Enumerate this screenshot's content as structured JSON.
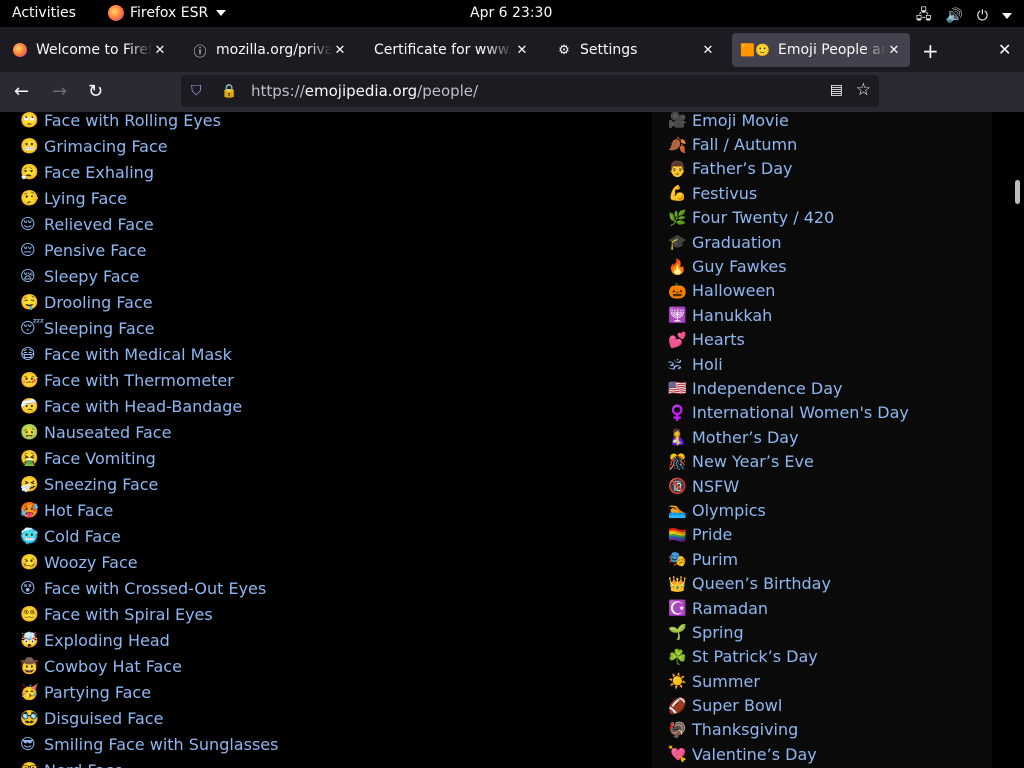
{
  "topbar": {
    "activities": "Activities",
    "app_name": "Firefox ESR",
    "clock": "Apr 6  23:30"
  },
  "tabs": [
    {
      "label": "Welcome to Firefox",
      "icon": "firefox-icon"
    },
    {
      "label": "mozilla.org/privacy",
      "icon": "info-icon"
    },
    {
      "label": "Certificate for www.mozilla",
      "icon": ""
    },
    {
      "label": "Settings",
      "icon": "gear-icon"
    },
    {
      "label": "Emoji People and Smileys",
      "icon": "emojipedia-icon"
    }
  ],
  "urlbar": {
    "prefix": "https://",
    "host": "emojipedia.org",
    "path": "/people/"
  },
  "left_list": [
    {
      "emoji": "🙄",
      "label": "Face with Rolling Eyes"
    },
    {
      "emoji": "😬",
      "label": "Grimacing Face"
    },
    {
      "emoji": "😮‍💨",
      "label": "Face Exhaling"
    },
    {
      "emoji": "🤥",
      "label": "Lying Face"
    },
    {
      "emoji": "😌",
      "label": "Relieved Face"
    },
    {
      "emoji": "😔",
      "label": "Pensive Face"
    },
    {
      "emoji": "😪",
      "label": "Sleepy Face"
    },
    {
      "emoji": "🤤",
      "label": "Drooling Face"
    },
    {
      "emoji": "😴",
      "label": "Sleeping Face"
    },
    {
      "emoji": "😷",
      "label": "Face with Medical Mask"
    },
    {
      "emoji": "🤒",
      "label": "Face with Thermometer"
    },
    {
      "emoji": "🤕",
      "label": "Face with Head-Bandage"
    },
    {
      "emoji": "🤢",
      "label": "Nauseated Face"
    },
    {
      "emoji": "🤮",
      "label": "Face Vomiting"
    },
    {
      "emoji": "🤧",
      "label": "Sneezing Face"
    },
    {
      "emoji": "🥵",
      "label": "Hot Face"
    },
    {
      "emoji": "🥶",
      "label": "Cold Face"
    },
    {
      "emoji": "🥴",
      "label": "Woozy Face"
    },
    {
      "emoji": "😵",
      "label": "Face with Crossed-Out Eyes"
    },
    {
      "emoji": "😵‍💫",
      "label": "Face with Spiral Eyes"
    },
    {
      "emoji": "🤯",
      "label": "Exploding Head"
    },
    {
      "emoji": "🤠",
      "label": "Cowboy Hat Face"
    },
    {
      "emoji": "🥳",
      "label": "Partying Face"
    },
    {
      "emoji": "🥸",
      "label": "Disguised Face"
    },
    {
      "emoji": "😎",
      "label": "Smiling Face with Sunglasses"
    },
    {
      "emoji": "🤓",
      "label": "Nerd Face"
    }
  ],
  "right_list": [
    {
      "emoji": "🎥",
      "label": "Emoji Movie"
    },
    {
      "emoji": "🍂",
      "label": "Fall / Autumn"
    },
    {
      "emoji": "👨",
      "label": "Father’s Day"
    },
    {
      "emoji": "💪",
      "label": "Festivus"
    },
    {
      "emoji": "🌿",
      "label": "Four Twenty / 420"
    },
    {
      "emoji": "🎓",
      "label": "Graduation"
    },
    {
      "emoji": "🔥",
      "label": "Guy Fawkes"
    },
    {
      "emoji": "🎃",
      "label": "Halloween"
    },
    {
      "emoji": "🕎",
      "label": "Hanukkah"
    },
    {
      "emoji": "💕",
      "label": "Hearts"
    },
    {
      "emoji": "🕉",
      "label": "Holi"
    },
    {
      "emoji": "🇺🇸",
      "label": "Independence Day"
    },
    {
      "emoji": "♀️",
      "label": "International Women's Day"
    },
    {
      "emoji": "🤱",
      "label": "Mother’s Day"
    },
    {
      "emoji": "🎊",
      "label": "New Year’s Eve"
    },
    {
      "emoji": "🔞",
      "label": "NSFW"
    },
    {
      "emoji": "🏊",
      "label": "Olympics"
    },
    {
      "emoji": "🏳️‍🌈",
      "label": "Pride"
    },
    {
      "emoji": "🎭",
      "label": "Purim"
    },
    {
      "emoji": "👑",
      "label": "Queen’s Birthday"
    },
    {
      "emoji": "☪️",
      "label": "Ramadan"
    },
    {
      "emoji": "🌱",
      "label": "Spring"
    },
    {
      "emoji": "☘️",
      "label": "St Patrick’s Day"
    },
    {
      "emoji": "☀️",
      "label": "Summer"
    },
    {
      "emoji": "🏈",
      "label": "Super Bowl"
    },
    {
      "emoji": "🦃",
      "label": "Thanksgiving"
    },
    {
      "emoji": "💘",
      "label": "Valentine’s Day"
    }
  ],
  "colors": {
    "link": "#8fb7f0",
    "toolbar": "#2b2a33",
    "tabbar": "#1c1b22",
    "active_tab": "#42414d"
  }
}
